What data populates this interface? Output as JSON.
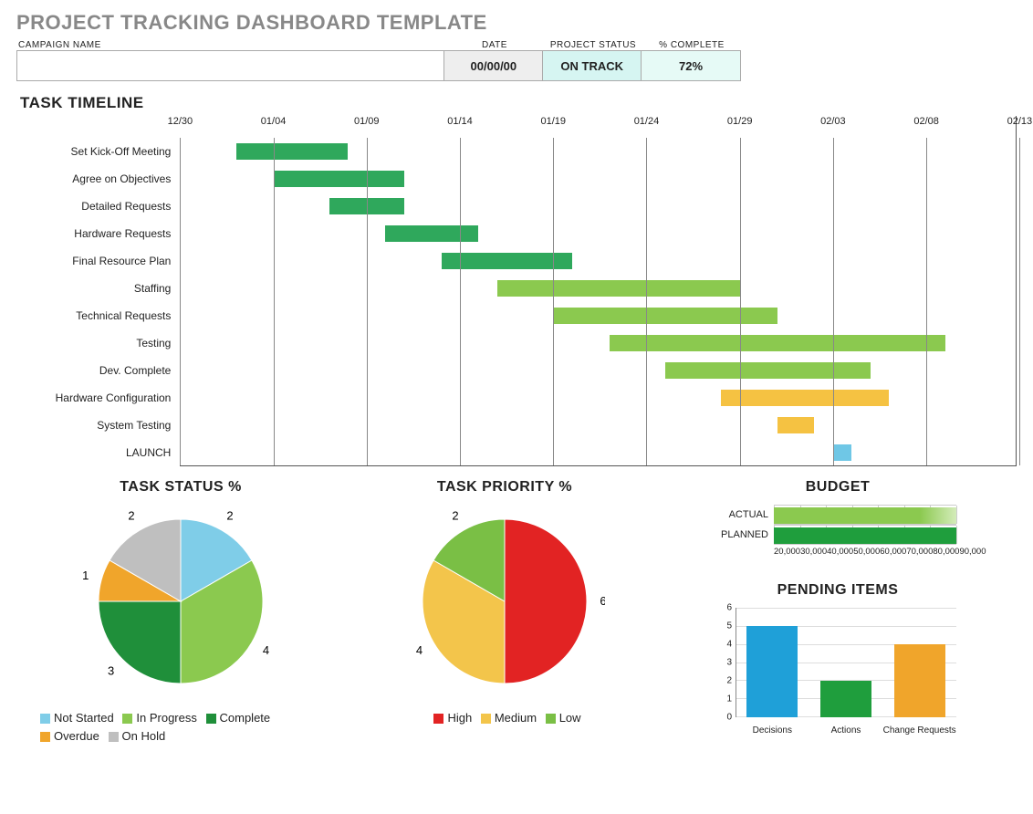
{
  "title": "PROJECT TRACKING DASHBOARD TEMPLATE",
  "header": {
    "labels": {
      "name": "CAMPAIGN NAME",
      "date": "DATE",
      "status": "PROJECT  STATUS",
      "pct": "% COMPLETE"
    },
    "values": {
      "name": "",
      "date": "00/00/00",
      "status": "ON TRACK",
      "pct": "72%"
    }
  },
  "sections": {
    "timeline": "TASK TIMELINE",
    "status": "TASK STATUS %",
    "priority": "TASK PRIORITY %",
    "budget": "BUDGET",
    "pending": "PENDING ITEMS"
  },
  "chart_data": [
    {
      "type": "gantt",
      "id": "timeline",
      "x_ticks": [
        "12/30",
        "01/04",
        "01/09",
        "01/14",
        "01/19",
        "01/24",
        "01/29",
        "02/03",
        "02/08",
        "02/13"
      ],
      "tasks": [
        {
          "name": "Set Kick-Off Meeting",
          "start": "01/02",
          "end": "01/08",
          "color": "dgreen"
        },
        {
          "name": "Agree on Objectives",
          "start": "01/04",
          "end": "01/11",
          "color": "dgreen"
        },
        {
          "name": "Detailed Requests",
          "start": "01/07",
          "end": "01/11",
          "color": "dgreen"
        },
        {
          "name": "Hardware Requests",
          "start": "01/10",
          "end": "01/15",
          "color": "dgreen"
        },
        {
          "name": "Final Resource Plan",
          "start": "01/13",
          "end": "01/20",
          "color": "dgreen"
        },
        {
          "name": "Staffing",
          "start": "01/16",
          "end": "01/29",
          "color": "lgreen"
        },
        {
          "name": "Technical Requests",
          "start": "01/19",
          "end": "01/31",
          "color": "lgreen"
        },
        {
          "name": "Testing",
          "start": "01/22",
          "end": "02/09",
          "color": "lgreen"
        },
        {
          "name": "Dev. Complete",
          "start": "01/25",
          "end": "02/05",
          "color": "lgreen"
        },
        {
          "name": "Hardware Configuration",
          "start": "01/28",
          "end": "02/06",
          "color": "yellow"
        },
        {
          "name": "System Testing",
          "start": "01/31",
          "end": "02/02",
          "color": "yellow"
        },
        {
          "name": "LAUNCH",
          "start": "02/03",
          "end": "02/04",
          "color": "blue"
        }
      ]
    },
    {
      "type": "pie",
      "id": "status",
      "title": "TASK STATUS %",
      "series": [
        {
          "name": "Not Started",
          "value": 2,
          "color": "#7fcde8"
        },
        {
          "name": "In Progress",
          "value": 4,
          "color": "#8bc94f"
        },
        {
          "name": "Complete",
          "value": 3,
          "color": "#1f8f3a"
        },
        {
          "name": "Overdue",
          "value": 1,
          "color": "#f0a52b"
        },
        {
          "name": "On Hold",
          "value": 2,
          "color": "#bfbfbf"
        }
      ]
    },
    {
      "type": "pie",
      "id": "priority",
      "title": "TASK PRIORITY %",
      "series": [
        {
          "name": "High",
          "value": 6,
          "color": "#e22323"
        },
        {
          "name": "Medium",
          "value": 4,
          "color": "#f3c54b"
        },
        {
          "name": "Low",
          "value": 2,
          "color": "#7abf45"
        }
      ]
    },
    {
      "type": "bar-horizontal",
      "id": "budget",
      "title": "BUDGET",
      "x_ticks": [
        20000,
        30000,
        40000,
        50000,
        60000,
        70000,
        80000,
        90000
      ],
      "series": [
        {
          "name": "ACTUAL",
          "value": 90000,
          "color": "#8bc94f"
        },
        {
          "name": "PLANNED",
          "value": 90000,
          "color": "#1f9e3d"
        }
      ]
    },
    {
      "type": "bar",
      "id": "pending",
      "title": "PENDING ITEMS",
      "ylim": [
        0,
        6
      ],
      "categories": [
        "Decisions",
        "Actions",
        "Change Requests"
      ],
      "values": [
        5,
        2,
        4
      ],
      "colors": [
        "#1fa0d8",
        "#1f9e3d",
        "#f0a52b"
      ]
    }
  ],
  "legends": {
    "status": [
      "Not Started",
      "In Progress",
      "Complete",
      "Overdue",
      "On Hold"
    ],
    "priority": [
      "High",
      "Medium",
      "Low"
    ]
  }
}
